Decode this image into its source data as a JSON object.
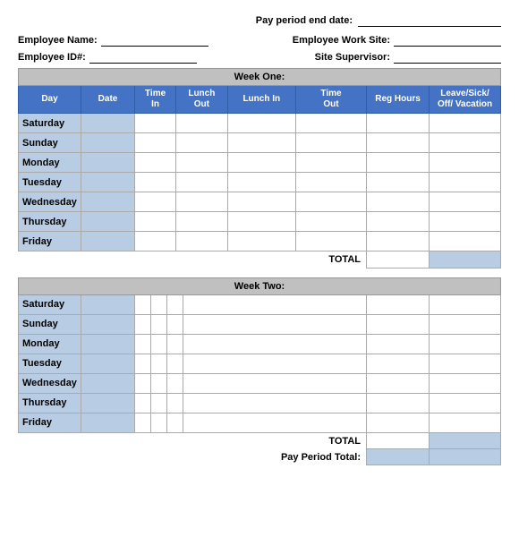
{
  "header": {
    "pay_period_label": "Pay period end date:",
    "employee_name_label": "Employee Name:",
    "employee_work_site_label": "Employee Work Site:",
    "employee_id_label": "Employee ID#:",
    "site_supervisor_label": "Site Supervisor:"
  },
  "week_one": {
    "title": "Week One:",
    "columns": [
      "Day",
      "Date",
      "Time\nIn",
      "Lunch\nOut",
      "Lunch In",
      "Time\nOut",
      "Reg Hours",
      "Leave/Sick/\nOff/ Vacation"
    ],
    "days": [
      "Saturday",
      "Sunday",
      "Monday",
      "Tuesday",
      "Wednesday",
      "Thursday",
      "Friday"
    ],
    "total_label": "TOTAL"
  },
  "week_two": {
    "title": "Week Two:",
    "days": [
      "Saturday",
      "Sunday",
      "Monday",
      "Tuesday",
      "Wednesday",
      "Thursday",
      "Friday"
    ],
    "total_label": "TOTAL"
  },
  "pay_period_total_label": "Pay Period Total:"
}
